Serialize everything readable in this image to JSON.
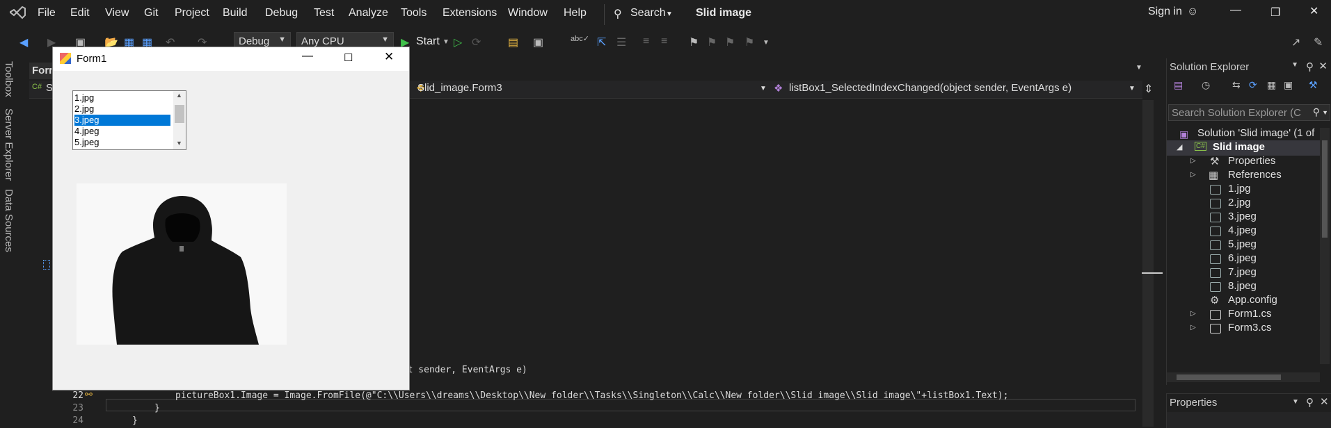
{
  "menu": {
    "items": [
      "File",
      "Edit",
      "View",
      "Git",
      "Project",
      "Build",
      "Debug",
      "Test",
      "Analyze",
      "Tools",
      "Extensions",
      "Window",
      "Help"
    ],
    "search": "Search",
    "solution_title": "Slid image",
    "sign_in": "Sign in"
  },
  "toolbar": {
    "config": "Debug",
    "platform": "Any CPU",
    "start": "Start"
  },
  "left_panels": [
    "Toolbox",
    "Server Explorer",
    "Data Sources"
  ],
  "editor": {
    "tab_label": "Form",
    "nav_project": "S",
    "nav_class": "Slid_image.Form3",
    "nav_member": "listBox1_SelectedIndexChanged(object sender, EventArgs e)",
    "lines": [
      {
        "num": "22",
        "code": "pictureBox1.Image = Image.FromFile(@\"C:\\\\Users\\\\dreams\\\\Desktop\\\\New folder\\\\Tasks\\\\Singleton\\\\Calc\\\\New folder\\\\Slid image\\\\Slid image\\\"+listBox1.Text);"
      },
      {
        "num": "23",
        "code": "}"
      },
      {
        "num": "24",
        "code": "}"
      }
    ],
    "partial_line": "ect sender, EventArgs e)"
  },
  "form": {
    "title": "Form1",
    "list_items": [
      "1.jpg",
      "2.jpg",
      "3.jpeg",
      "4.jpeg",
      "5.jpeg"
    ],
    "selected_index": 2
  },
  "solution_explorer": {
    "title": "Solution Explorer",
    "search_placeholder": "Search Solution Explorer (C",
    "solution_label": "Solution 'Slid image' (1 of",
    "project": "Slid image",
    "nodes": [
      "Properties",
      "References",
      "1.jpg",
      "2.jpg",
      "3.jpeg",
      "4.jpeg",
      "5.jpeg",
      "6.jpeg",
      "7.jpeg",
      "8.jpeg",
      "App.config",
      "Form1.cs",
      "Form3.cs"
    ]
  },
  "properties": {
    "title": "Properties"
  },
  "colors": {
    "accent": "#0078d7",
    "keyword": "#569cd6",
    "type": "#4ec9b0",
    "string": "#d69d85"
  }
}
